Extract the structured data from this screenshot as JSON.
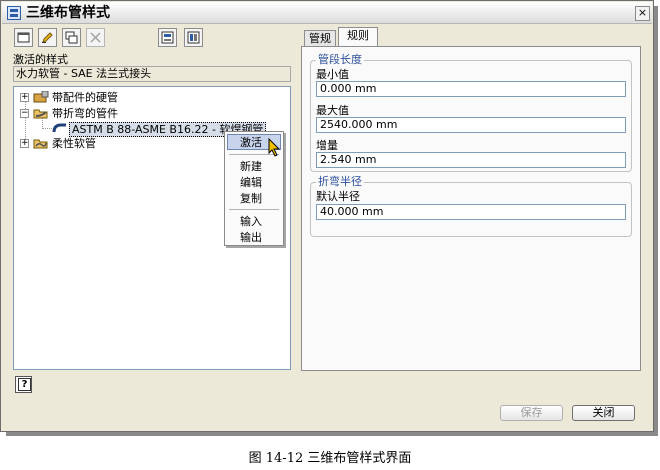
{
  "window": {
    "title": "三维布管样式",
    "close_glyph": "×"
  },
  "toolbar": {
    "icons": [
      "new-style-icon",
      "edit-style-icon",
      "copy-style-icon",
      "delete-style-icon",
      "import-icon",
      "export-icon"
    ]
  },
  "left": {
    "active_label": "激活的样式",
    "active_value": "水力软管 - SAE 法兰式接头",
    "tree": [
      {
        "label": "带配件的硬管",
        "expander": "+"
      },
      {
        "label": "带折弯的管件",
        "expander": "−"
      },
      {
        "label": "ASTM B 88-ASME B16.22 - 软焊钢管"
      },
      {
        "label": "柔性软管",
        "expander": "+"
      }
    ]
  },
  "context_menu": {
    "items": [
      "激活",
      "新建",
      "编辑",
      "复制",
      "输入",
      "输出"
    ]
  },
  "tabs": [
    "管规",
    "规则"
  ],
  "rules": {
    "segment_group": "管段长度",
    "min_label": "最小值",
    "min_value": "0.000 mm",
    "max_label": "最大值",
    "max_value": "2540.000 mm",
    "inc_label": "增量",
    "inc_value": "2.540 mm",
    "bend_group": "折弯半径",
    "radius_label": "默认半径",
    "radius_value": "40.000 mm"
  },
  "buttons": {
    "save": "保存",
    "close": "关闭"
  },
  "caption": "图 14-12  三维布管样式界面",
  "colors": {
    "accent": "#2b4f9b",
    "background": "#ece9d8",
    "selection": "#c7d4ec"
  }
}
